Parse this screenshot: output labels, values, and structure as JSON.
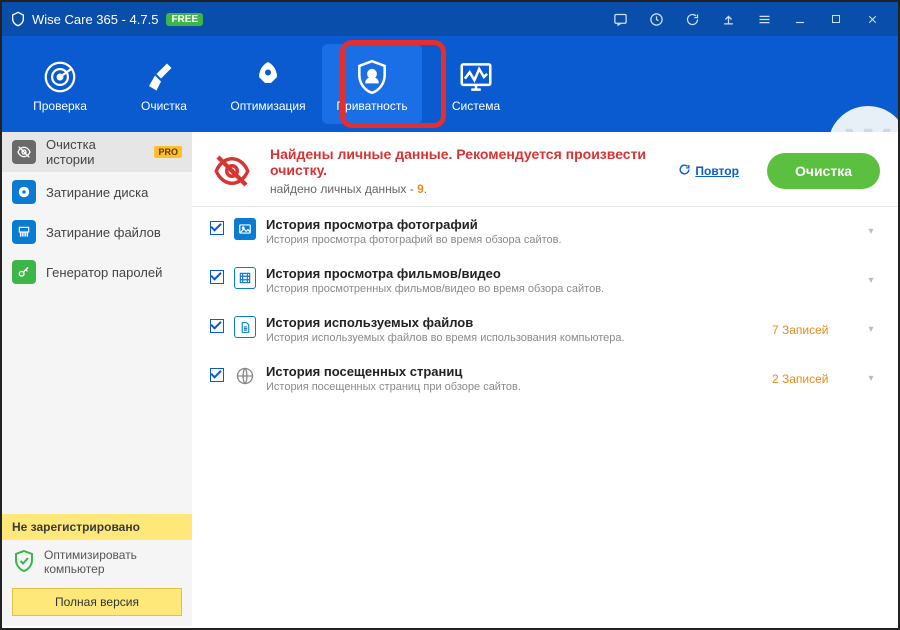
{
  "window": {
    "title": "Wise Care 365 - 4.7.5",
    "free_badge": "FREE"
  },
  "nav": {
    "items": [
      {
        "label": "Проверка"
      },
      {
        "label": "Очистка"
      },
      {
        "label": "Оптимизация"
      },
      {
        "label": "Приватность"
      },
      {
        "label": "Система"
      }
    ]
  },
  "sidebar": {
    "items": [
      {
        "label": "Очистка истории",
        "pro": "PRO"
      },
      {
        "label": "Затирание диска"
      },
      {
        "label": "Затирание файлов"
      },
      {
        "label": "Генератор паролей"
      }
    ],
    "not_registered": "Не зарегистрировано",
    "optimize_pc": "Оптимизировать компьютер",
    "full_version": "Полная версия"
  },
  "alert": {
    "title": "Найдены личные данные. Рекомендуется произвести очистку.",
    "subtitle_prefix": "найдено личных данных - ",
    "count": "9",
    "subtitle_suffix": ".",
    "retry": "Повтор",
    "clean_button": "Очистка"
  },
  "rows": [
    {
      "title": "История просмотра фотографий",
      "desc": "История просмотра фотографий во время обзора сайтов.",
      "count": ""
    },
    {
      "title": "История просмотра фильмов/видео",
      "desc": "История просмотренных фильмов/видео во время обзора сайтов.",
      "count": ""
    },
    {
      "title": "История используемых файлов",
      "desc": "История используемых файлов во время использования компьютера.",
      "count": "7 Записей"
    },
    {
      "title": "История посещенных страниц",
      "desc": "История посещенных страниц при обзоре сайтов.",
      "count": "2 Записей"
    }
  ],
  "colors": {
    "accent": "#0a5bd0",
    "green": "#5bbf3f",
    "red": "#d93434",
    "orange": "#e88b1a",
    "yellow": "#ffe87a"
  }
}
